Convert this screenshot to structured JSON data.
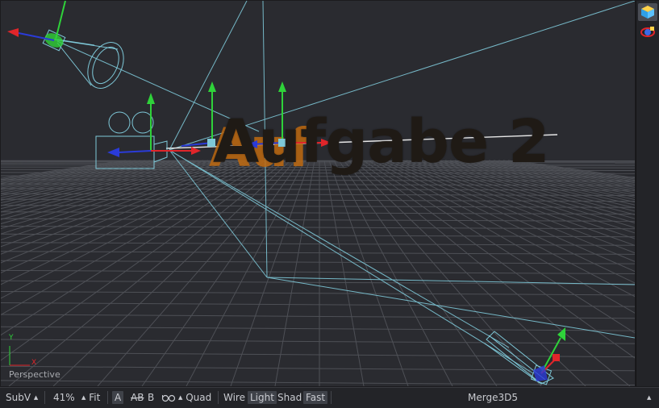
{
  "viewport": {
    "overlay_text": "Aufgabe 2",
    "view_name": "Perspective",
    "axis_y": "Y",
    "axis_x": "X"
  },
  "right_toolbar": [
    {
      "icon": "cube-view-icon",
      "active": true
    },
    {
      "icon": "lighting-sphere-icon",
      "active": false
    }
  ],
  "status_bar": {
    "subview": "SubV",
    "zoom": "41%",
    "fit": "Fit",
    "a_label": "A",
    "ab_label": "AB",
    "b_label": "B",
    "quad": "Quad",
    "wire": "Wire",
    "light": "Light",
    "shad": "Shad",
    "fast": "Fast",
    "node_name": "Merge3D5"
  },
  "colors": {
    "viewport_bg": "#2a2b30",
    "wire_cyan": "#7ec8d8",
    "axis_green": "#2fd23a",
    "axis_red": "#e0252a",
    "axis_blue": "#2a3bd8",
    "text_orange": "#c06a10"
  }
}
